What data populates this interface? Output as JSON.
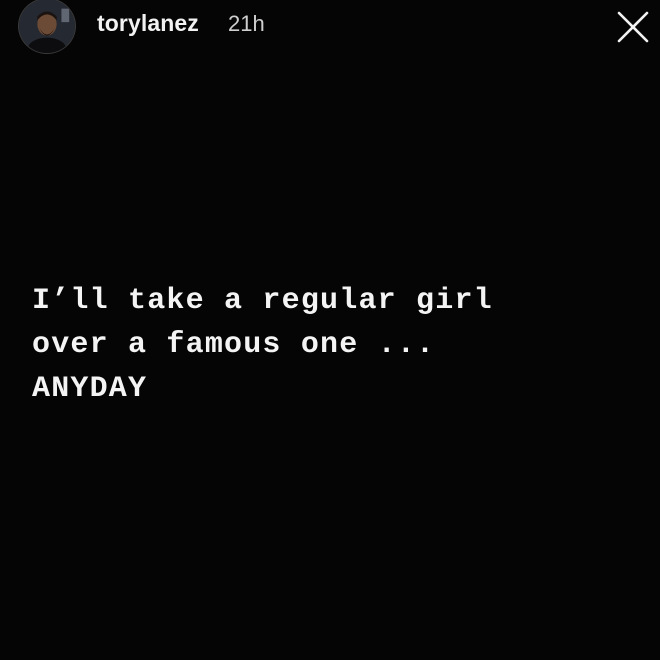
{
  "header": {
    "username": "torylanez",
    "timestamp": "21h",
    "avatar_icon": "profile-avatar",
    "close_icon": "close-icon"
  },
  "story": {
    "lines": [
      "I’ll take a regular girl",
      "over a famous one ...",
      "ANYDAY"
    ]
  },
  "colors": {
    "background": "#050505",
    "text": "#f4f4f4",
    "timestamp": "#cfcfcf"
  }
}
